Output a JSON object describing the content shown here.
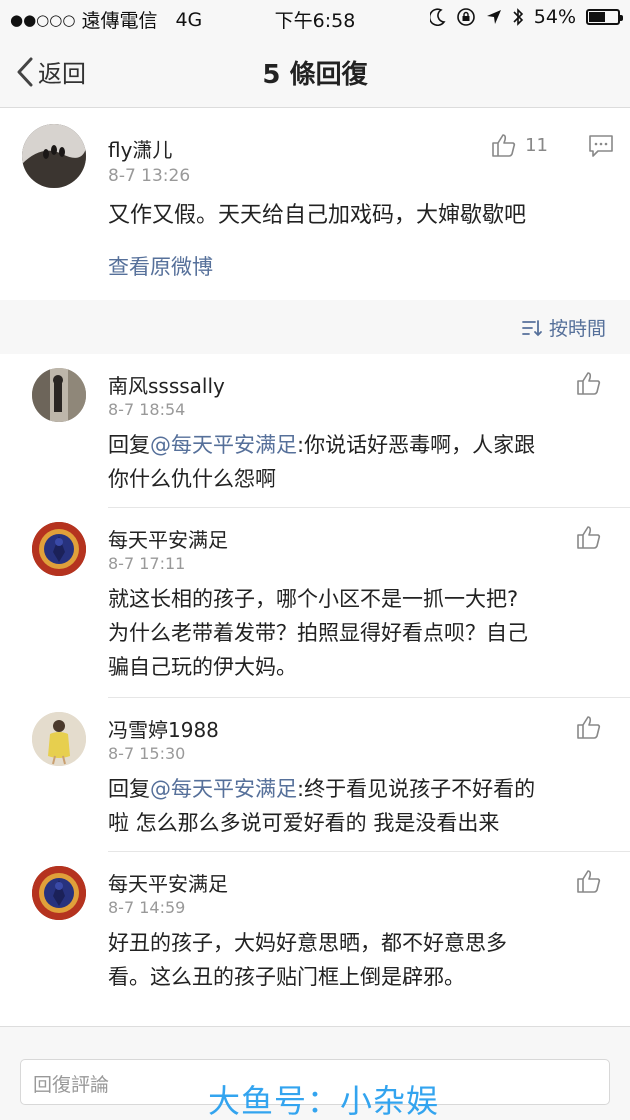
{
  "status_bar": {
    "signal": "●●○○○",
    "carrier": "遠傳電信",
    "network": "4G",
    "time": "下午6:58",
    "battery_percent": "54%",
    "battery_level": 0.54
  },
  "nav": {
    "back_label": "返回",
    "title": "5 條回復"
  },
  "original_post": {
    "user": "fly潇儿",
    "time": "8-7 13:26",
    "text": "又作又假。天天给自己加戏码，大婶歇歇吧",
    "like_count": "11",
    "view_original": "查看原微博"
  },
  "sort": {
    "label": "按時間"
  },
  "comments": [
    {
      "user": "南风ssssally",
      "time": "8-7 18:54",
      "reply_prefix": "回复",
      "mention": "@每天平安满足",
      "line1_rest": ":你说话好恶毒啊，人家跟",
      "line2": "你什么仇什么怨啊"
    },
    {
      "user": "每天平安满足",
      "time": "8-7 17:11",
      "line1": "就这长相的孩子，哪个小区不是一抓一大把?",
      "line2": "为什么老带着发带？拍照显得好看点呗？自己",
      "line3": "骗自己玩的伊大妈。"
    },
    {
      "user": "冯雪婷1988",
      "time": "8-7 15:30",
      "reply_prefix": "回复",
      "mention": "@每天平安满足",
      "line1_rest": ":终于看见说孩子不好看的",
      "line2": "啦 怎么那么多说可爱好看的 我是没看出来"
    },
    {
      "user": "每天平安满足",
      "time": "8-7 14:59",
      "line1": "好丑的孩子，大妈好意思晒，都不好意思多",
      "line2": "看。这么丑的孩子贴门框上倒是辟邪。"
    }
  ],
  "reply_box": {
    "placeholder": "回復評論"
  },
  "watermark": "大鱼号：小杂娱"
}
